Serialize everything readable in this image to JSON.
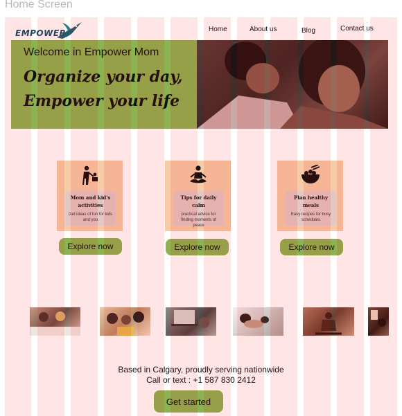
{
  "frame": {
    "title": "Home Screen"
  },
  "header": {
    "logo_text": "EMPOWER",
    "nav": [
      "Home",
      "About us",
      "Blog",
      "Contact us"
    ]
  },
  "hero": {
    "welcome": "Welcome in Empower Mom",
    "headline_line1": "Organize your day,",
    "headline_line2": "Empower your life"
  },
  "cards": [
    {
      "icon": "parent-child-icon",
      "title": "Mom and kid's activities",
      "desc": "Get ideas of fun for kids and you",
      "button": "Explore now"
    },
    {
      "icon": "meditation-icon",
      "title": "Tips for daily calm",
      "desc": "practical advice for finding moments of peace",
      "button": "Explore now"
    },
    {
      "icon": "food-bowl-icon",
      "title": "Plan healthy meals",
      "desc": "Easy recipes for busy schedules",
      "button": "Explore now"
    }
  ],
  "footer": {
    "line1": "Based in Calgary, proudly serving nationwide",
    "line2": "Call or text : +1 587 830 2412",
    "cta": "Get started"
  },
  "colors": {
    "accent_green": "#8bb351",
    "card_peach": "#f5cba8",
    "card_inner": "#e2c7c5",
    "layout_grid": "#ffe0e0"
  }
}
